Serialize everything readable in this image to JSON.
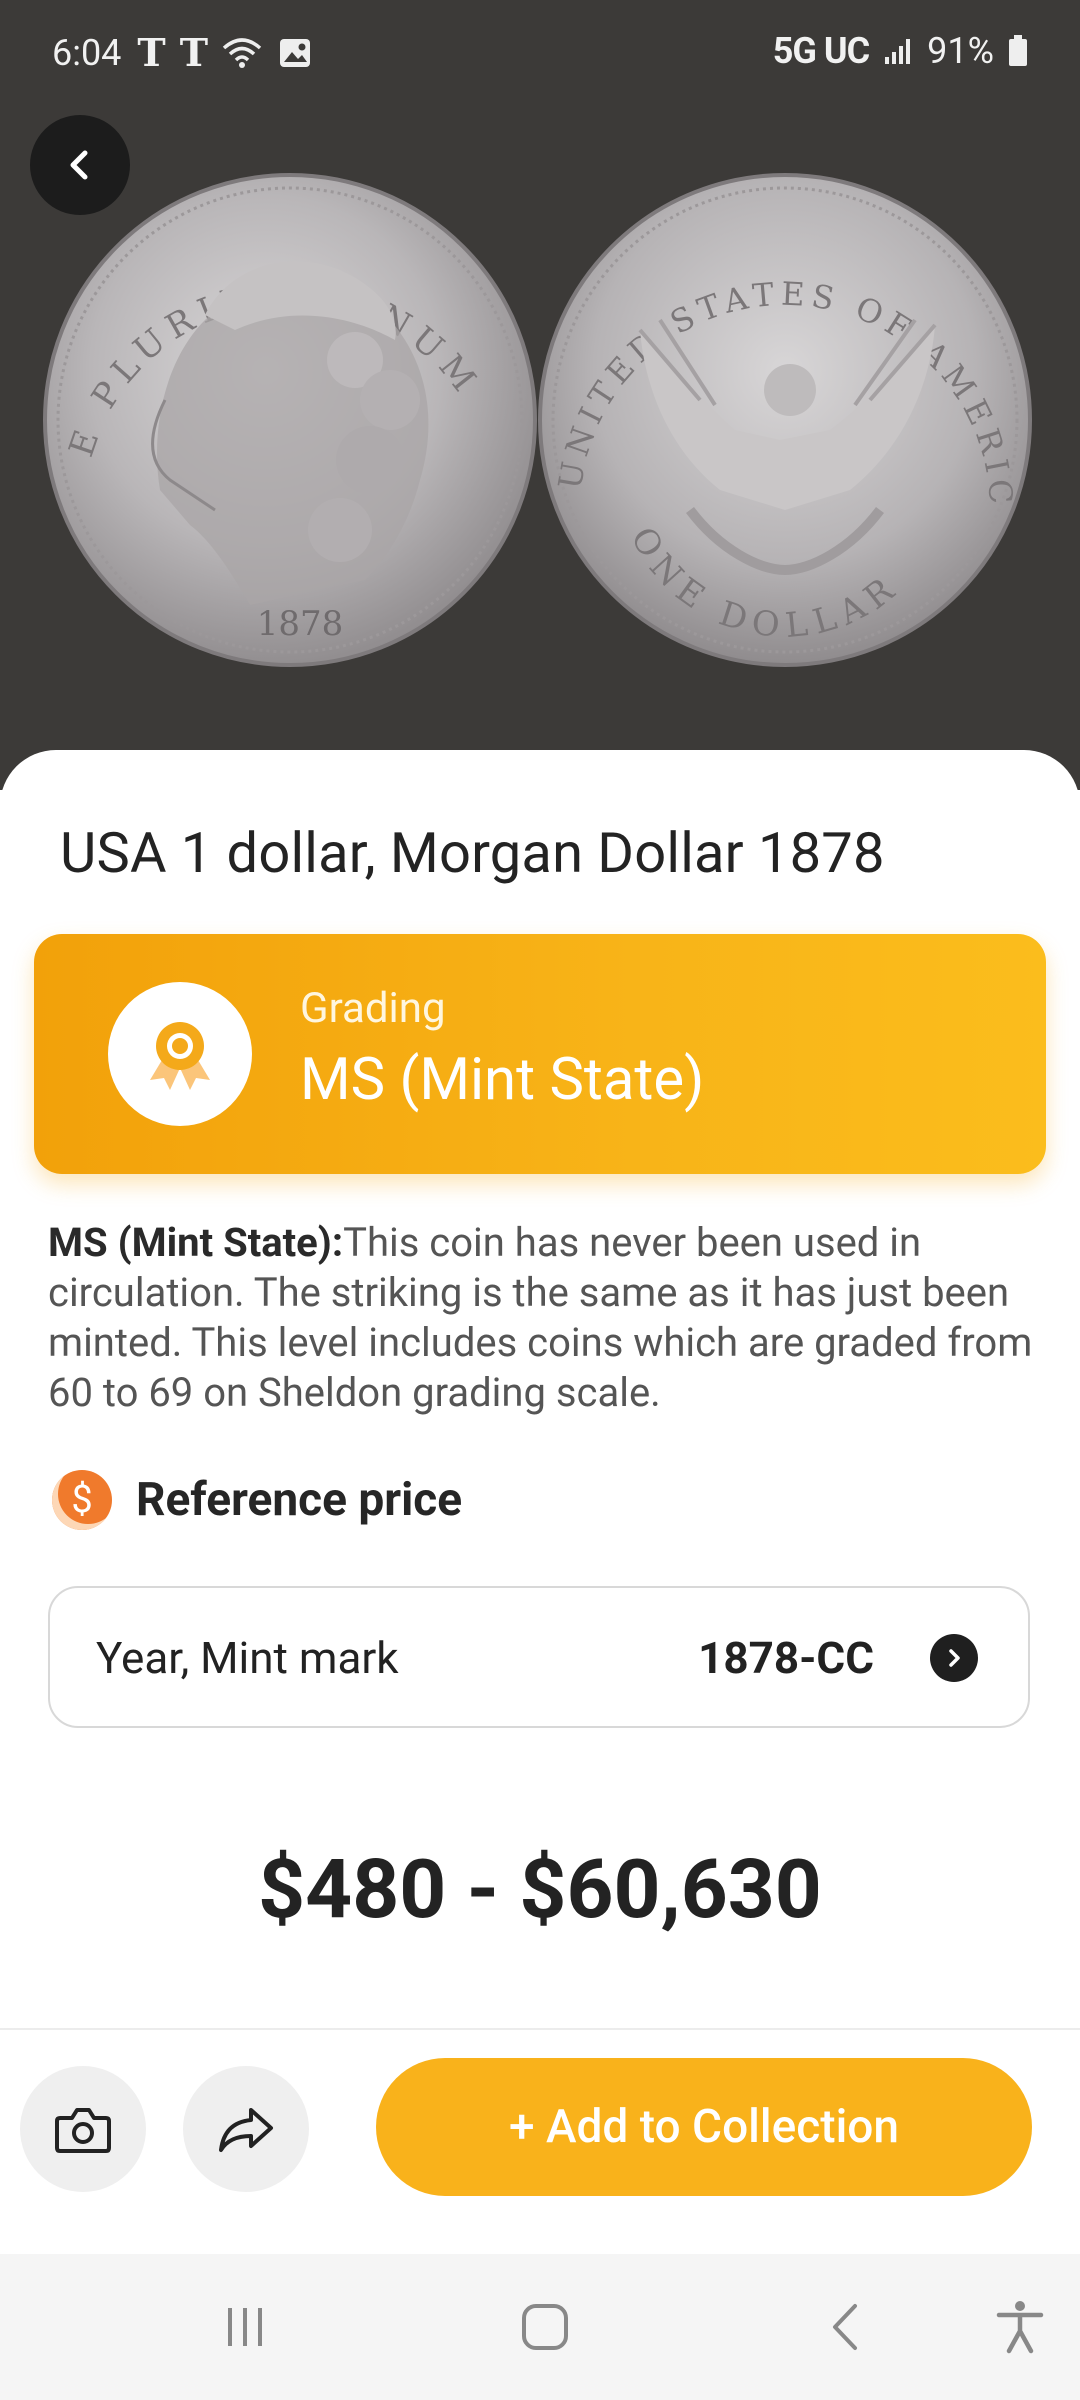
{
  "status_bar": {
    "time": "6:04",
    "network": "5G UC",
    "battery": "91%"
  },
  "coin": {
    "obverse_year": "1878",
    "obverse_legend": "E PLURIBUS UNUM",
    "reverse_legend": "UNITED STATES OF AMERICA",
    "reverse_denomination": "ONE DOLLAR"
  },
  "title": "USA 1 dollar, Morgan Dollar 1878",
  "grading": {
    "label": "Grading",
    "value": "MS (Mint State)"
  },
  "description": {
    "term": "MS (Mint State):",
    "text": "This coin has never been used in circulation. The striking is the same as it has just been minted. This level includes coins which are graded from 60 to 69 on Sheldon grading scale."
  },
  "reference_price": {
    "title": "Reference price",
    "icon_symbol": "$"
  },
  "mint_selector": {
    "label": "Year, Mint mark",
    "value": "1878-CC"
  },
  "price_range": "$480 - $60,630",
  "actions": {
    "add_label": "+ Add to Collection"
  },
  "colors": {
    "accent": "#f9b21b",
    "hero_bg": "#3c3a38",
    "dollar_icon": "#f07a2c"
  }
}
